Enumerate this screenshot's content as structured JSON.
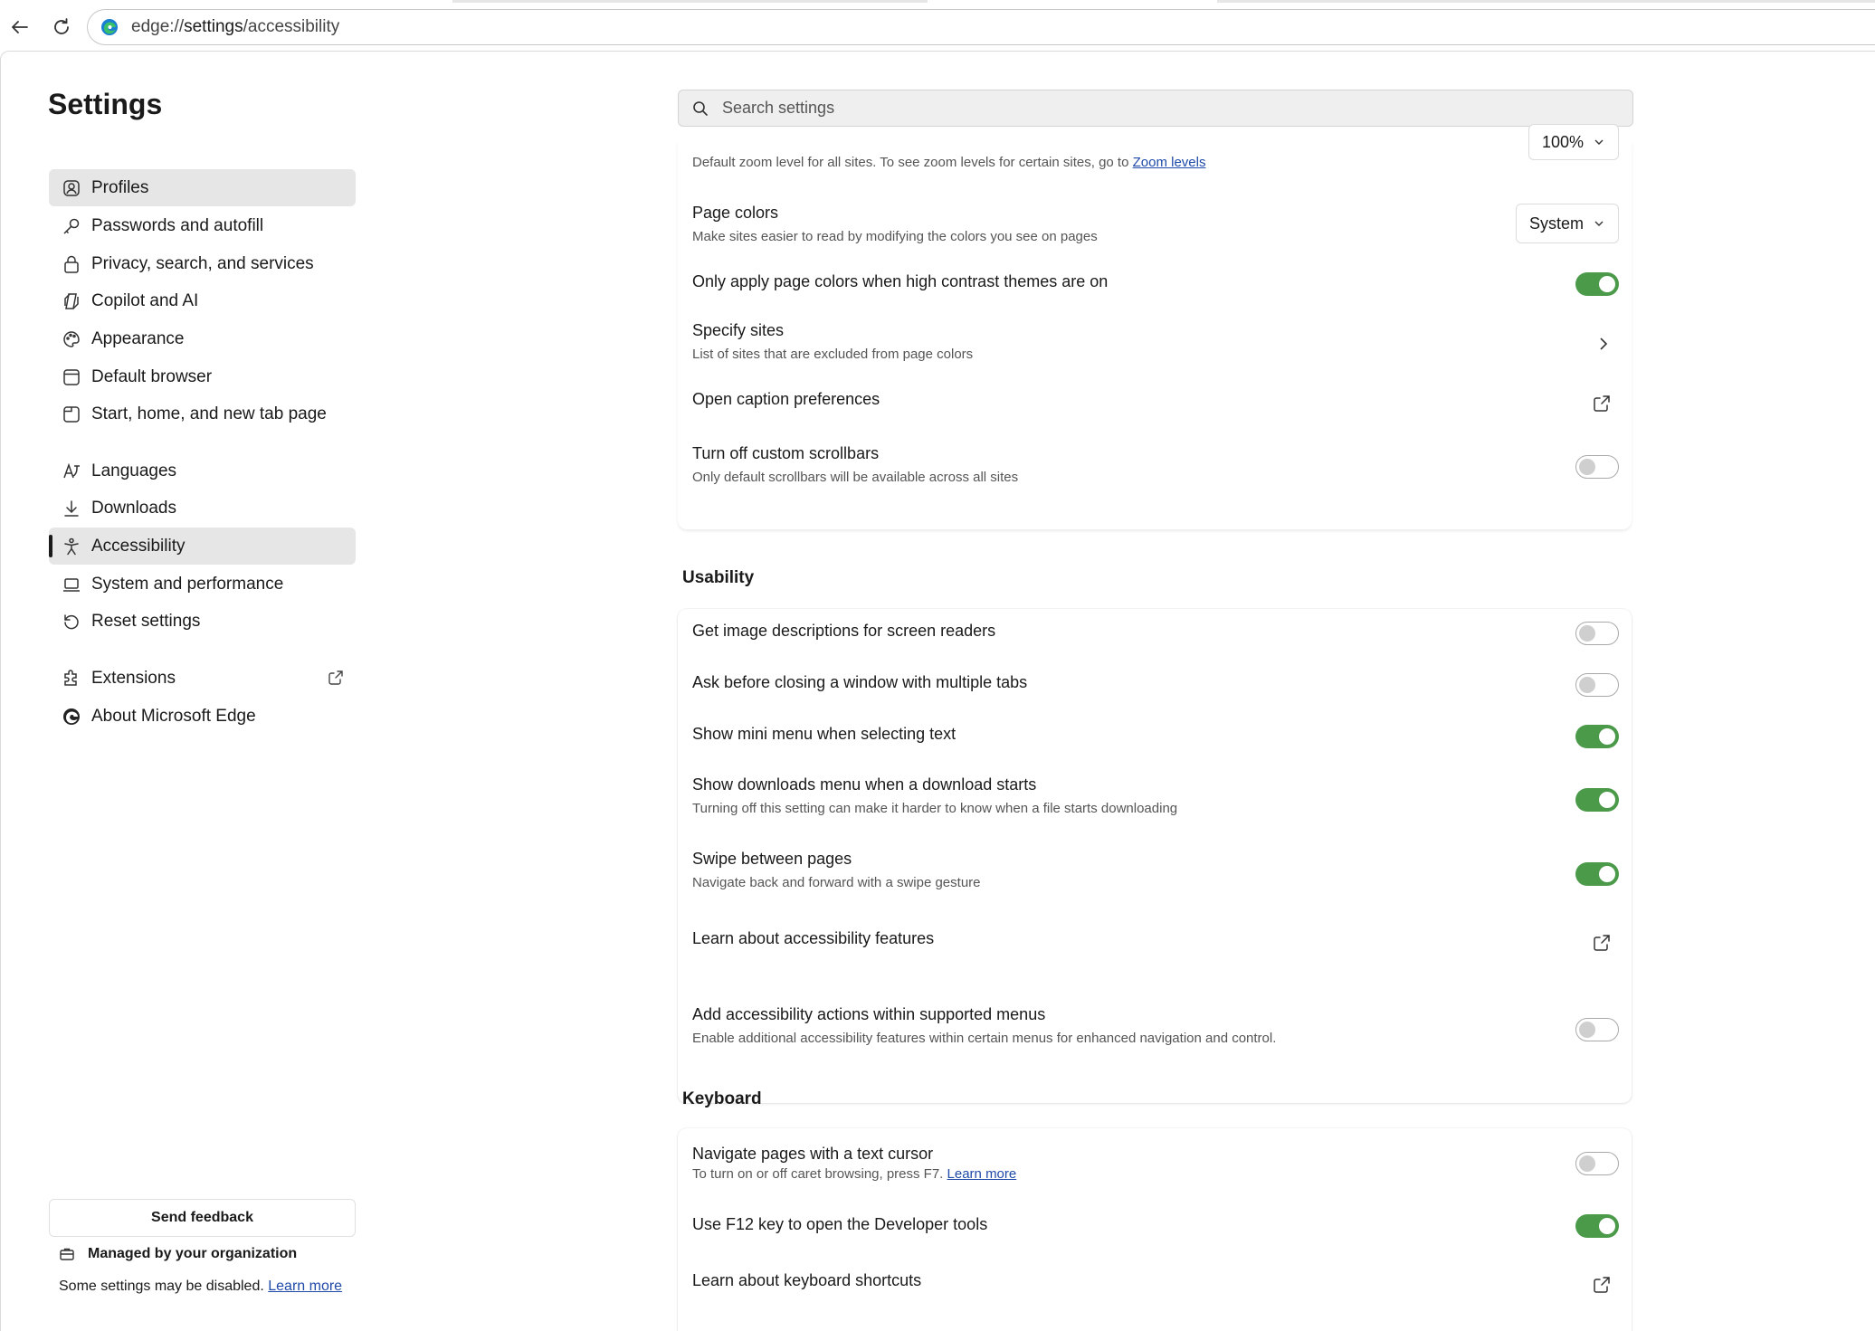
{
  "browser": {
    "url_scheme": "edge://",
    "url_host": "settings",
    "url_path": "/accessibility"
  },
  "sidebar": {
    "title": "Settings",
    "items": [
      {
        "label": "Profiles",
        "icon": "profile-icon"
      },
      {
        "label": "Passwords and autofill",
        "icon": "key-icon"
      },
      {
        "label": "Privacy, search, and services",
        "icon": "lock-icon"
      },
      {
        "label": "Copilot and AI",
        "icon": "copilot-icon"
      },
      {
        "label": "Appearance",
        "icon": "palette-icon"
      },
      {
        "label": "Default browser",
        "icon": "browser-icon"
      },
      {
        "label": "Start, home, and new tab page",
        "icon": "home-tab-icon"
      },
      {
        "label": "Languages",
        "icon": "languages-icon"
      },
      {
        "label": "Downloads",
        "icon": "download-icon"
      },
      {
        "label": "Accessibility",
        "icon": "accessibility-icon"
      },
      {
        "label": "System and performance",
        "icon": "laptop-icon"
      },
      {
        "label": "Reset settings",
        "icon": "reset-icon"
      },
      {
        "label": "Extensions",
        "icon": "puzzle-icon"
      },
      {
        "label": "About Microsoft Edge",
        "icon": "edge-logo-icon"
      }
    ],
    "feedback": "Send feedback",
    "managed": "Managed by your organization",
    "managed_note": "Some settings may be disabled.",
    "learn_more": "Learn more"
  },
  "search": {
    "placeholder": "Search settings"
  },
  "display": {
    "zoom_value": "100%",
    "zoom_desc": "Default zoom level for all sites. To see zoom levels for certain sites, go to",
    "zoom_link": "Zoom levels",
    "page_colors_title": "Page colors",
    "page_colors_desc": "Make sites easier to read by modifying the colors you see on pages",
    "page_colors_value": "System",
    "high_contrast_title": "Only apply page colors when high contrast themes are on",
    "high_contrast_on": true,
    "specify_sites_title": "Specify sites",
    "specify_sites_desc": "List of sites that are excluded from page colors",
    "caption_title": "Open caption preferences",
    "scrollbars_title": "Turn off custom scrollbars",
    "scrollbars_desc": "Only default scrollbars will be available across all sites",
    "scrollbars_on": false
  },
  "usability": {
    "heading": "Usability",
    "image_desc_title": "Get image descriptions for screen readers",
    "image_desc_on": false,
    "ask_close_title": "Ask before closing a window with multiple tabs",
    "ask_close_on": false,
    "mini_menu_title": "Show mini menu when selecting text",
    "mini_menu_on": true,
    "downloads_menu_title": "Show downloads menu when a download starts",
    "downloads_menu_desc": "Turning off this setting can make it harder to know when a file starts downloading",
    "downloads_menu_on": true,
    "swipe_title": "Swipe between pages",
    "swipe_desc": "Navigate back and forward with a swipe gesture",
    "swipe_on": true,
    "learn_a11y_title": "Learn about accessibility features",
    "menu_actions_title": "Add accessibility actions within supported menus",
    "menu_actions_desc": "Enable additional accessibility features within certain menus for enhanced navigation and control.",
    "menu_actions_on": false
  },
  "keyboard": {
    "heading": "Keyboard",
    "caret_title": "Navigate pages with a text cursor",
    "caret_desc": "To turn on or off caret browsing, press F7.",
    "caret_link": "Learn more",
    "caret_on": false,
    "f12_title": "Use F12 key to open the Developer tools",
    "f12_on": true,
    "shortcuts_title": "Learn about keyboard shortcuts"
  },
  "colors": {
    "toggle_on": "#4a9a4a",
    "link": "#1f4aa8",
    "active_nav": "#e6e6e6"
  }
}
